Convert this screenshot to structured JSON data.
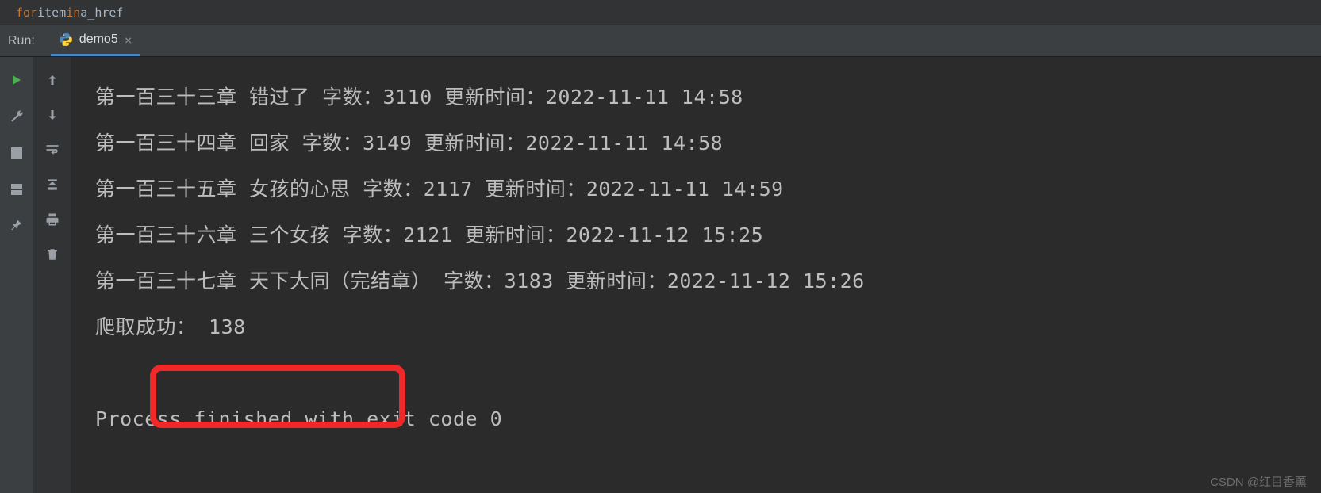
{
  "editor": {
    "code_kw1": "for",
    "code_txt1": " item ",
    "code_kw2": "in",
    "code_txt2": " a_href"
  },
  "run": {
    "label": "Run:",
    "tab_name": "demo5",
    "tab_close": "×"
  },
  "console": {
    "lines": [
      "第一百三十三章 错过了 字数：3110 更新时间：2022-11-11 14:58",
      "第一百三十四章 回家 字数：3149 更新时间：2022-11-11 14:58",
      "第一百三十五章 女孩的心思 字数：2117 更新时间：2022-11-11 14:59",
      "第一百三十六章 三个女孩 字数：2121 更新时间：2022-11-12 15:25",
      "第一百三十七章 天下大同（完结章） 字数：3183 更新时间：2022-11-12 15:26",
      "爬取成功： 138"
    ],
    "process": "Process finished with exit code 0"
  },
  "watermark": "CSDN @红目香薰"
}
